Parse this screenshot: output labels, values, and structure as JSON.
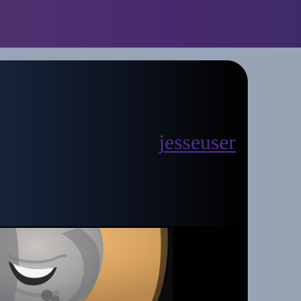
{
  "header": {},
  "profile": {
    "username": "jesseuser",
    "photo_icon": "profile-photo"
  },
  "colors": {
    "topbar": "#4b2b6d",
    "page_background": "#97a4b6",
    "card_background": "#000000",
    "link": "#4f2f93"
  }
}
